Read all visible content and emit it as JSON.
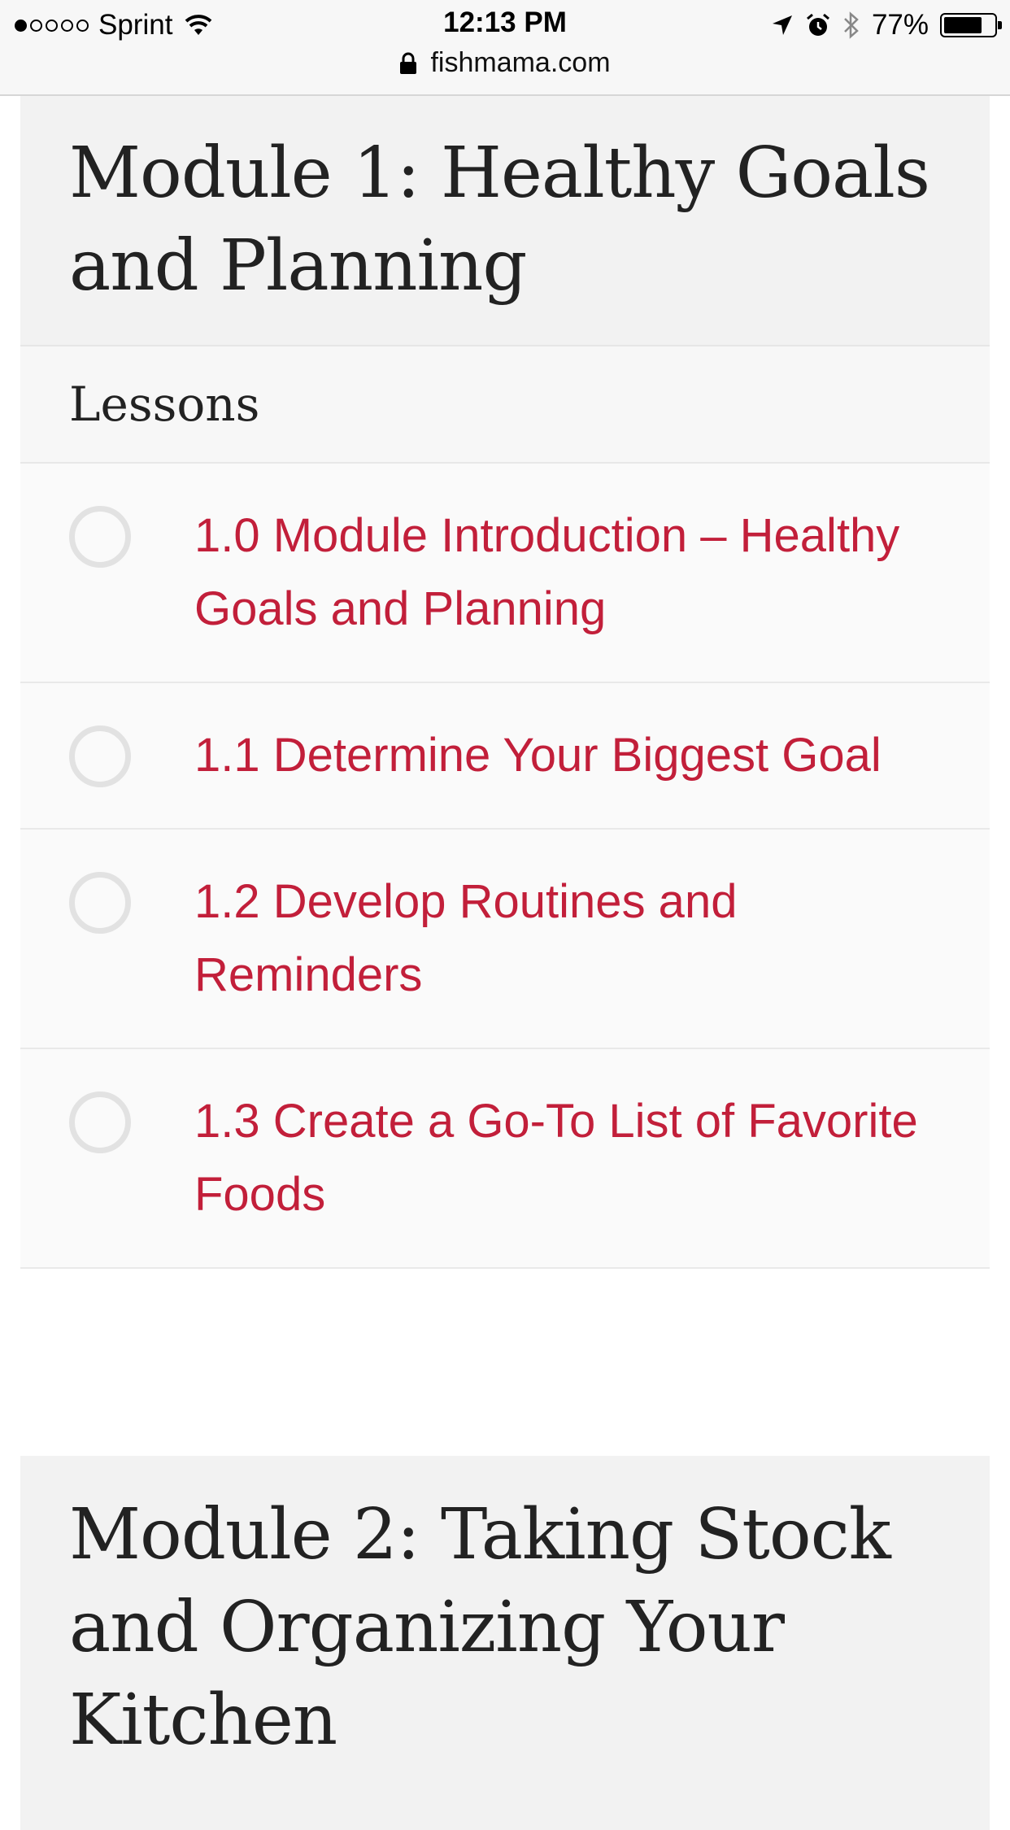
{
  "status_bar": {
    "carrier": "Sprint",
    "time": "12:13 PM",
    "battery_percent": "77%",
    "battery_level": 0.77,
    "url": "fishmama.com"
  },
  "module1": {
    "title": "Module 1: Healthy Goals and Planning",
    "lessons_label": "Lessons",
    "lessons": [
      {
        "label": "1.0 Module Introduction – Healthy Goals and Planning"
      },
      {
        "label": "1.1 Determine Your Biggest Goal"
      },
      {
        "label": "1.2 Develop Routines and Reminders"
      },
      {
        "label": "1.3 Create a Go-To List of Favorite Foods"
      }
    ]
  },
  "module2": {
    "title": "Module 2: Taking Stock and Organizing Your Kitchen"
  },
  "colors": {
    "accent": "#c21f3a",
    "header_bg": "#f2f2f2"
  }
}
